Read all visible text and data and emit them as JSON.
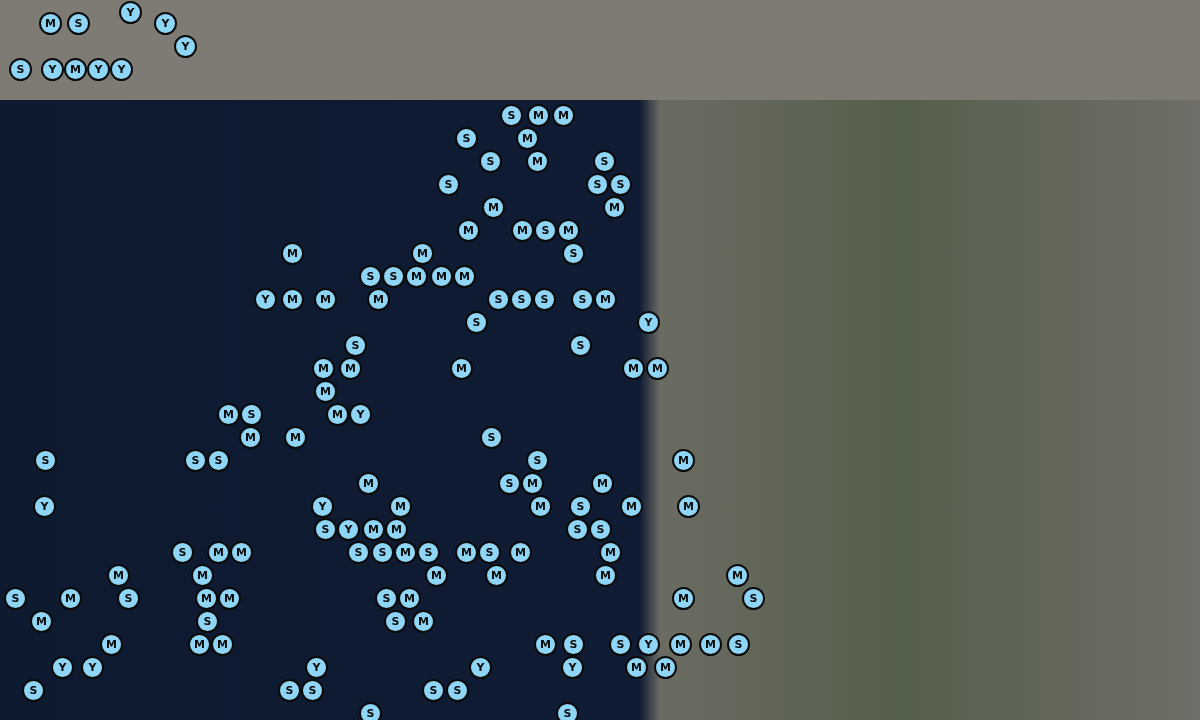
{
  "map": {
    "markers": [
      {
        "label": "Y"
      },
      {
        "label": "M"
      },
      {
        "label": "S"
      },
      {
        "label": "Y"
      },
      {
        "label": "Y"
      },
      {
        "label": "S"
      },
      {
        "label": "Y"
      },
      {
        "label": "M"
      },
      {
        "label": "Y"
      },
      {
        "label": "Y"
      },
      {
        "label": "S"
      },
      {
        "label": "M"
      },
      {
        "label": "M"
      },
      {
        "label": "S"
      },
      {
        "label": "M"
      },
      {
        "label": "S"
      },
      {
        "label": "M"
      },
      {
        "label": "S"
      },
      {
        "label": "S"
      },
      {
        "label": "S"
      },
      {
        "label": "S"
      },
      {
        "label": "M"
      },
      {
        "label": "M"
      },
      {
        "label": "M"
      },
      {
        "label": "M"
      },
      {
        "label": "S"
      },
      {
        "label": "M"
      },
      {
        "label": "M"
      },
      {
        "label": "M"
      },
      {
        "label": "S"
      },
      {
        "label": "S"
      },
      {
        "label": "S"
      },
      {
        "label": "M"
      },
      {
        "label": "M"
      },
      {
        "label": "M"
      },
      {
        "label": "Y"
      },
      {
        "label": "M"
      },
      {
        "label": "M"
      },
      {
        "label": "M"
      },
      {
        "label": "S"
      },
      {
        "label": "S"
      },
      {
        "label": "S"
      },
      {
        "label": "S"
      },
      {
        "label": "M"
      },
      {
        "label": "S"
      },
      {
        "label": "Y"
      },
      {
        "label": "S"
      },
      {
        "label": "S"
      },
      {
        "label": "M"
      },
      {
        "label": "M"
      },
      {
        "label": "M"
      },
      {
        "label": "M"
      },
      {
        "label": "M"
      },
      {
        "label": "M"
      },
      {
        "label": "M"
      },
      {
        "label": "S"
      },
      {
        "label": "M"
      },
      {
        "label": "Y"
      },
      {
        "label": "M"
      },
      {
        "label": "M"
      },
      {
        "label": "S"
      },
      {
        "label": "S"
      },
      {
        "label": "S"
      },
      {
        "label": "S"
      },
      {
        "label": "S"
      },
      {
        "label": "M"
      },
      {
        "label": "M"
      },
      {
        "label": "S"
      },
      {
        "label": "M"
      },
      {
        "label": "M"
      },
      {
        "label": "Y"
      },
      {
        "label": "Y"
      },
      {
        "label": "M"
      },
      {
        "label": "M"
      },
      {
        "label": "S"
      },
      {
        "label": "M"
      },
      {
        "label": "M"
      },
      {
        "label": "S"
      },
      {
        "label": "Y"
      },
      {
        "label": "M"
      },
      {
        "label": "M"
      },
      {
        "label": "S"
      },
      {
        "label": "S"
      },
      {
        "label": "S"
      },
      {
        "label": "M"
      },
      {
        "label": "M"
      },
      {
        "label": "S"
      },
      {
        "label": "S"
      },
      {
        "label": "M"
      },
      {
        "label": "S"
      },
      {
        "label": "M"
      },
      {
        "label": "S"
      },
      {
        "label": "M"
      },
      {
        "label": "M"
      },
      {
        "label": "M"
      },
      {
        "label": "M"
      },
      {
        "label": "M"
      },
      {
        "label": "M"
      },
      {
        "label": "M"
      },
      {
        "label": "M"
      },
      {
        "label": "S"
      },
      {
        "label": "M"
      },
      {
        "label": "S"
      },
      {
        "label": "M"
      },
      {
        "label": "M"
      },
      {
        "label": "S"
      },
      {
        "label": "M"
      },
      {
        "label": "M"
      },
      {
        "label": "S"
      },
      {
        "label": "M"
      },
      {
        "label": "S"
      },
      {
        "label": "S"
      },
      {
        "label": "M"
      },
      {
        "label": "M"
      },
      {
        "label": "M"
      },
      {
        "label": "M"
      },
      {
        "label": "M"
      },
      {
        "label": "S"
      },
      {
        "label": "S"
      },
      {
        "label": "Y"
      },
      {
        "label": "M"
      },
      {
        "label": "M"
      },
      {
        "label": "S"
      },
      {
        "label": "Y"
      },
      {
        "label": "Y"
      },
      {
        "label": "Y"
      },
      {
        "label": "Y"
      },
      {
        "label": "Y"
      },
      {
        "label": "M"
      },
      {
        "label": "M"
      },
      {
        "label": "S"
      },
      {
        "label": "S"
      },
      {
        "label": "S"
      },
      {
        "label": "S"
      },
      {
        "label": "S"
      },
      {
        "label": "S"
      },
      {
        "label": "S"
      }
    ]
  }
}
